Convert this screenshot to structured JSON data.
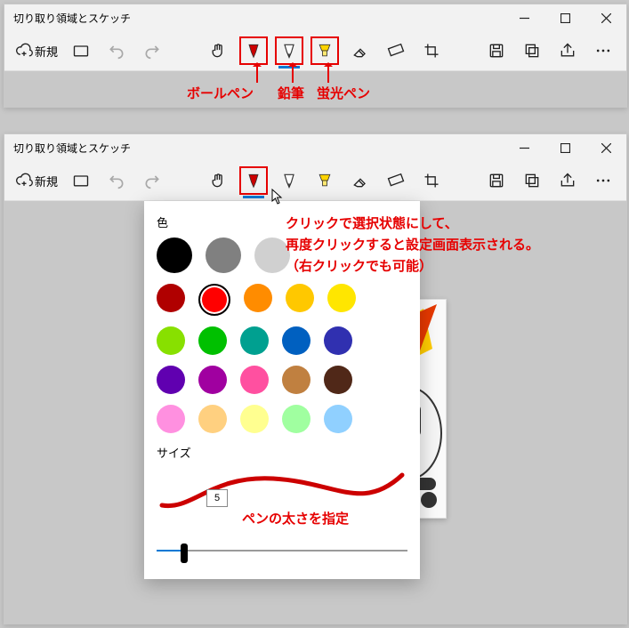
{
  "app_title": "切り取り領域とスケッチ",
  "toolbar": {
    "new_label": "新規"
  },
  "annotations": {
    "ballpoint": "ボールペン",
    "pencil": "鉛筆",
    "highlighter": "蛍光ペン",
    "click_note_1": "クリックで選択状態にして、",
    "click_note_2": "再度クリックすると設定画面表示される。",
    "click_note_3": "（右クリックでも可能）",
    "size_note": "ペンの太さを指定"
  },
  "popup": {
    "color_label": "色",
    "size_label": "サイズ",
    "size_value": "5",
    "slider_percent": 11,
    "top_row": [
      "#000000",
      "#808080",
      "#d0d0d0"
    ],
    "palette": [
      [
        "#b00000",
        "#ff0000",
        "#ff8c00",
        "#ffc800",
        "#ffe600"
      ],
      [
        "#88e000",
        "#00c000",
        "#00a090",
        "#0060c0",
        "#3030b0"
      ],
      [
        "#6000b0",
        "#a000a0",
        "#ff50a0",
        "#c08040",
        "#502818"
      ],
      [
        "#ff90e0",
        "#ffd080",
        "#ffff90",
        "#a0ffa0",
        "#90d0ff"
      ]
    ]
  }
}
